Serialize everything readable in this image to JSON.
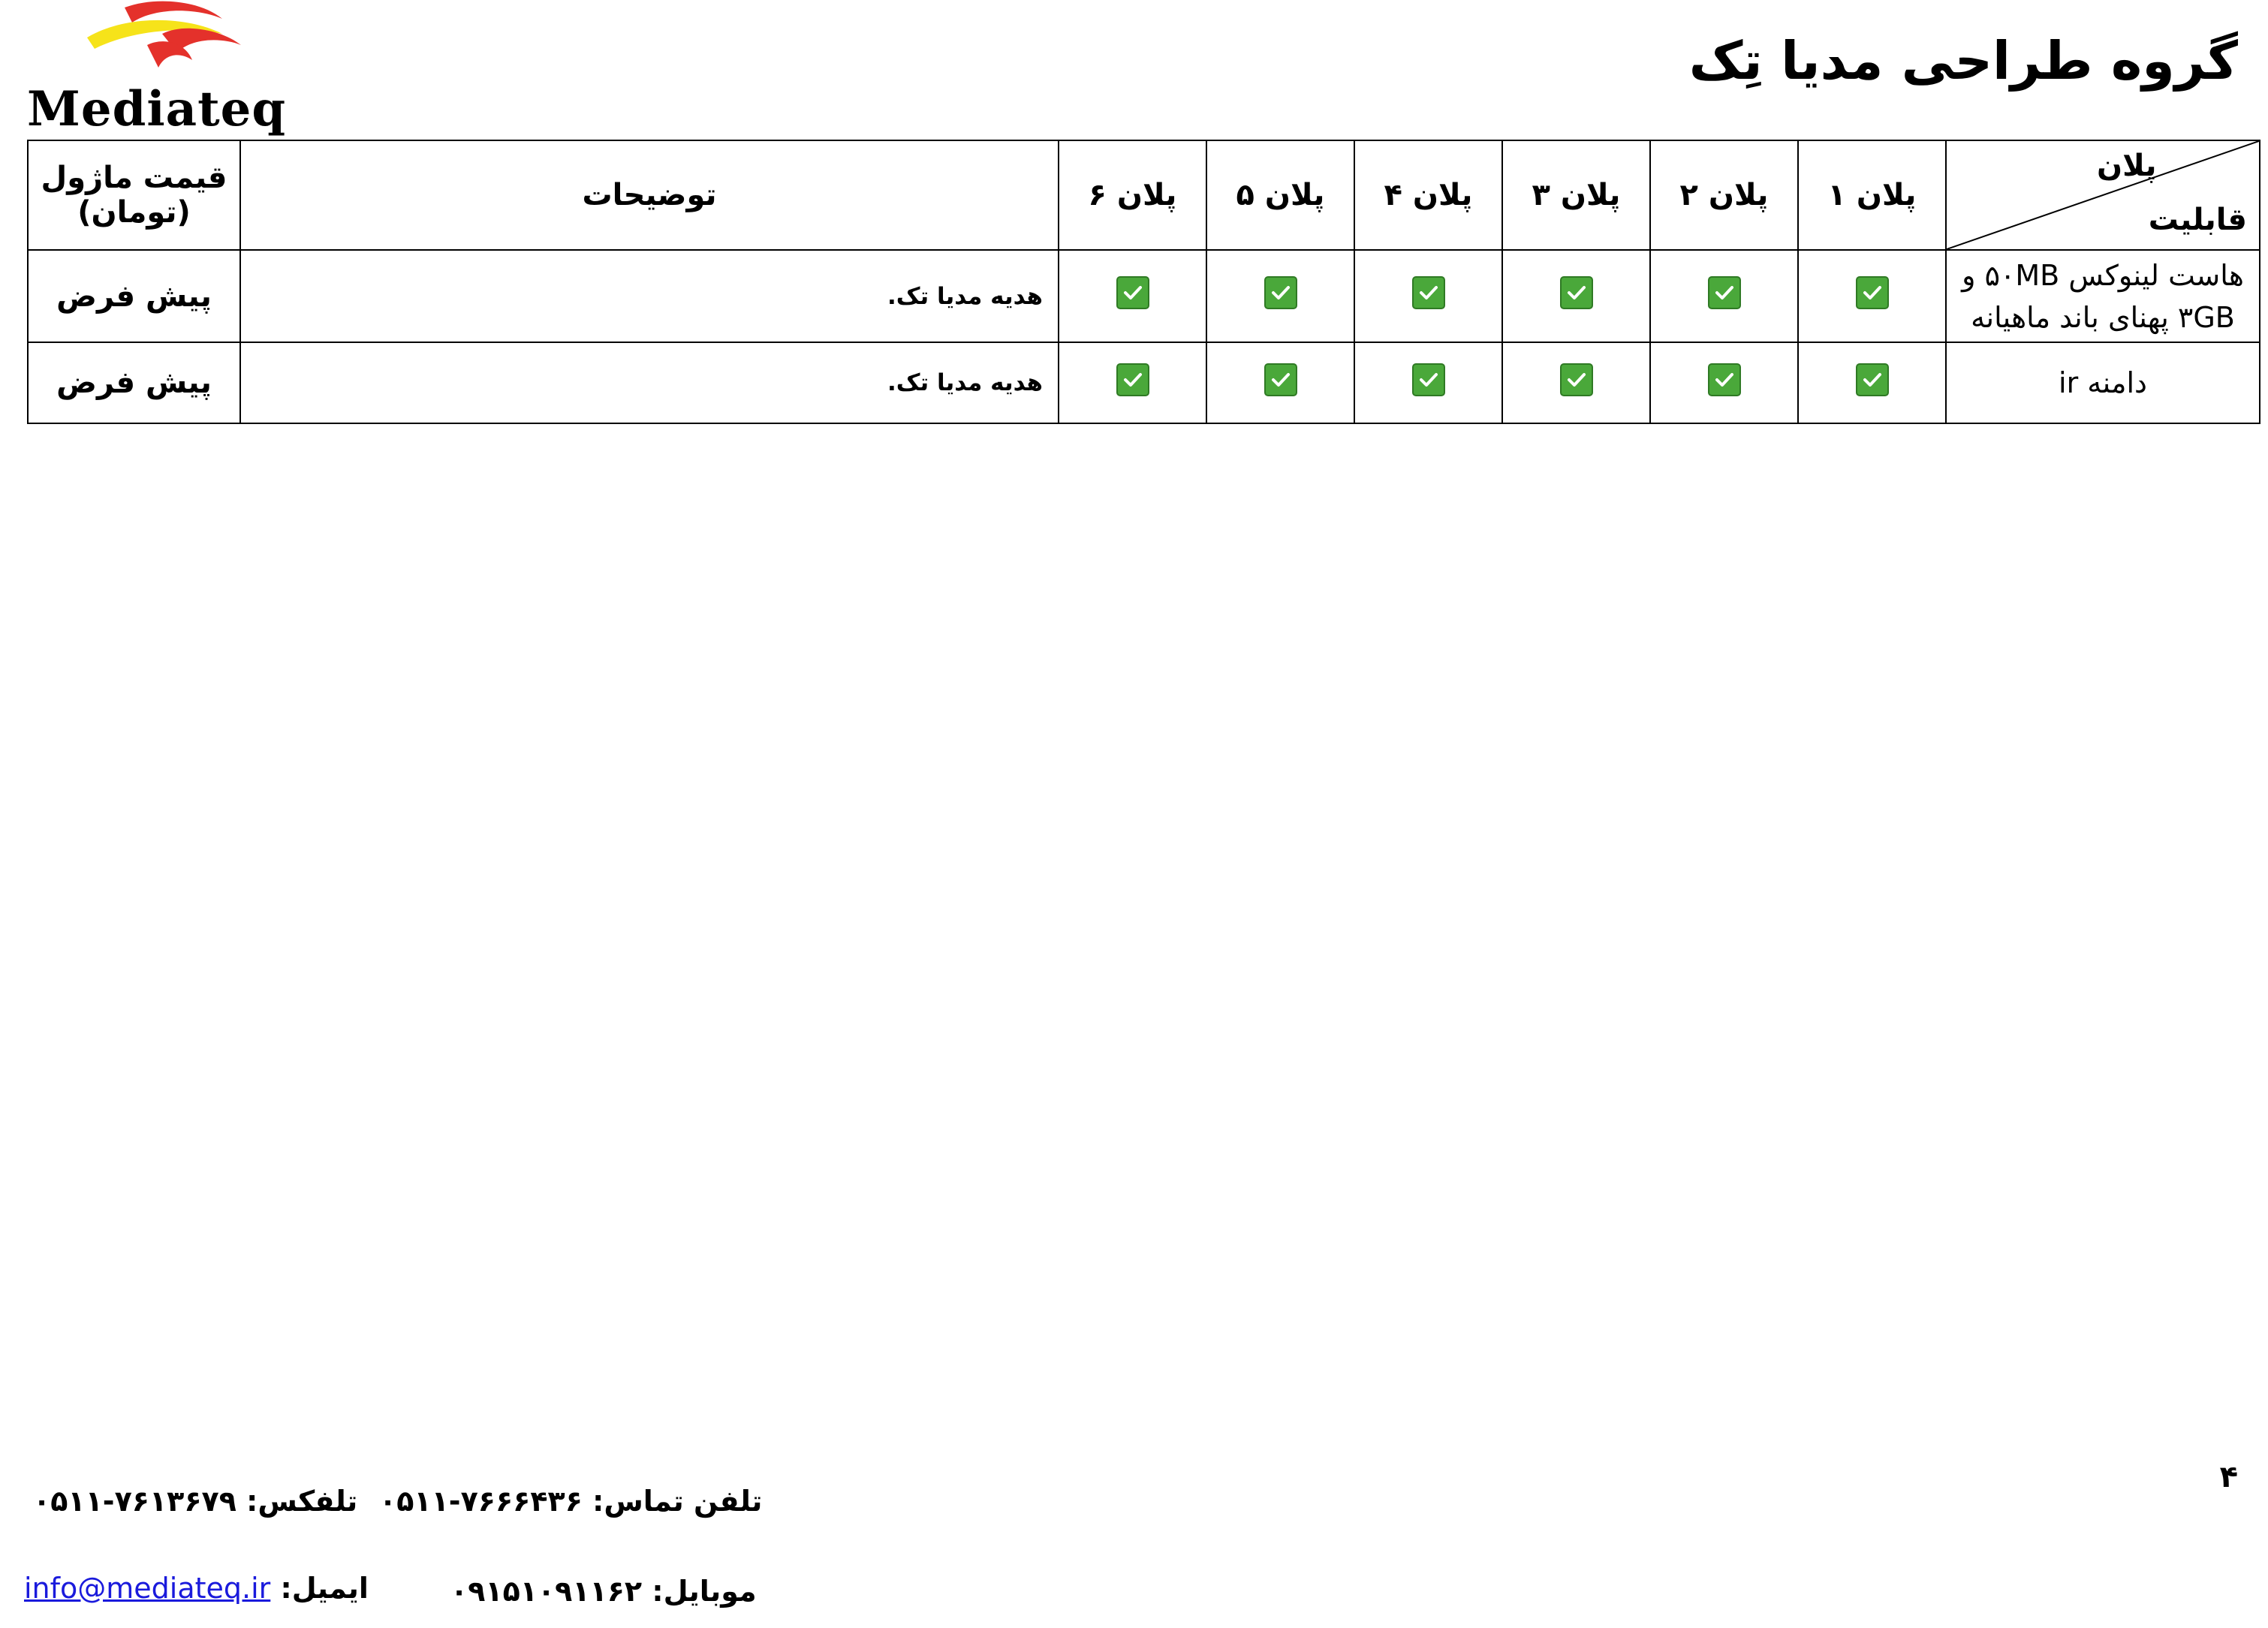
{
  "logo": {
    "text": "Mediateq",
    "colors": {
      "red": "#e4312b",
      "yellow": "#f6e31a"
    }
  },
  "header": {
    "title": "گروه طراحی مدیا تِک"
  },
  "table": {
    "corner": {
      "top": "پلان",
      "bottom": "قابلیت"
    },
    "plans": [
      "پلان ۱",
      "پلان ۲",
      "پلان ۳",
      "پلان ۴",
      "پلان ۵",
      "پلان ۶"
    ],
    "description_header": "توضیحات",
    "price_header_line1": "قیمت ماژول",
    "price_header_line2": "(تومان)",
    "rows": [
      {
        "feature_line1": "هاست لینوکس ۵۰MB و",
        "feature_line2": "۳GB پهنای باند ماهیانه",
        "checks": [
          true,
          true,
          true,
          true,
          true,
          true
        ],
        "description": "هدیه مدیا تک.",
        "price": "پیش فرض"
      },
      {
        "feature_line1": "دامنه ir",
        "feature_line2": "",
        "checks": [
          true,
          true,
          true,
          true,
          true,
          true
        ],
        "description": "هدیه مدیا تک.",
        "price": "پیش فرض"
      }
    ],
    "check_color": "#4aa83a"
  },
  "page_number": "۴",
  "footer": {
    "phone": "تلفن تماس: ۷۶۶۶۴۳۶-۰۵۱۱",
    "fax": "تلفکس: ۷۶۱۳۶۷۹-۰۵۱۱",
    "mobile": "موبایل: ۰۹۱۵۱۰۹۱۱۶۲",
    "email_label": "ایمیل:",
    "email": "info@mediateq.ir"
  }
}
